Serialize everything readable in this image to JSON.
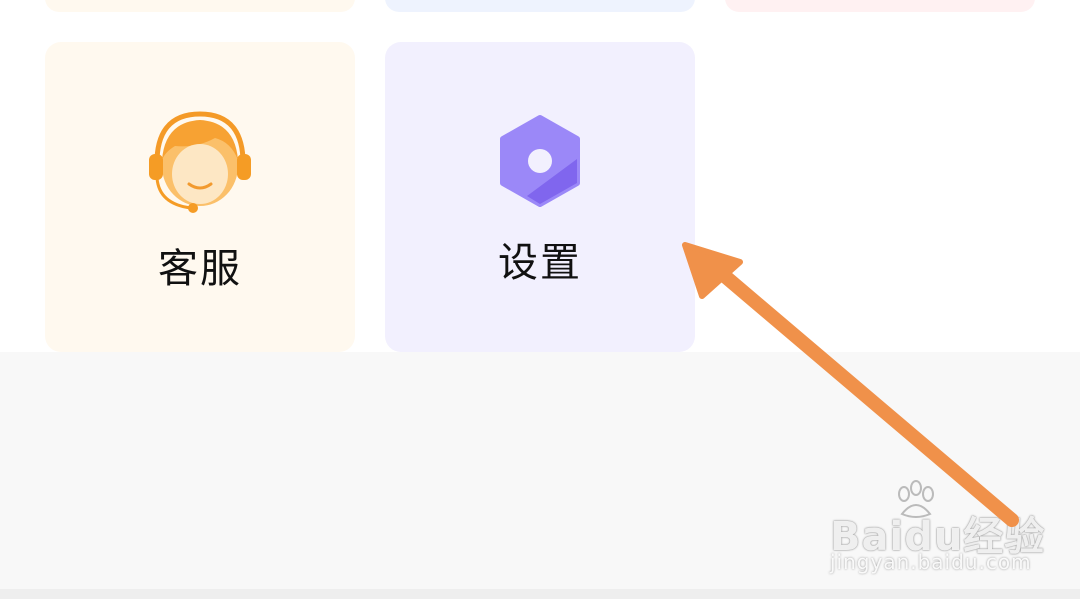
{
  "grid": {
    "cards": [
      {
        "label": "客服",
        "icon": "customer-service-headset-icon",
        "bg": "#fff9ef",
        "accent": "#f5a623"
      },
      {
        "label": "设置",
        "icon": "settings-hexagon-icon",
        "bg": "#f2f0fe",
        "accent": "#8b74f6"
      }
    ],
    "partial_cards_bg": [
      "#fff9ef",
      "#eef3fe",
      "#fff1f2"
    ]
  },
  "annotation": {
    "arrow_color": "#f0914a",
    "pointing_to": "settings"
  },
  "watermark": {
    "logo": "Baidu经验",
    "url": "jingyan.baidu.com"
  }
}
